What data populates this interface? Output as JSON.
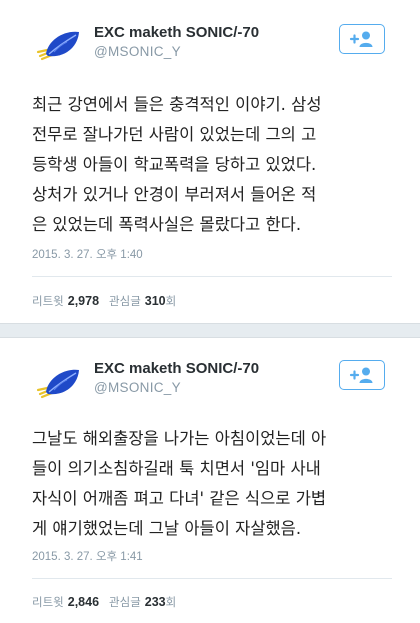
{
  "colors": {
    "accent": "#55acee",
    "meta": "#8899a6",
    "text": "#292f33",
    "separator": "#e6ecf0"
  },
  "tweets": [
    {
      "display_name": "EXC maketh SONIC/-70",
      "handle": "@MSONIC_Y",
      "avatar_icon": "blue-leaf-avatar-icon",
      "follow_icon": "add-user-icon",
      "text": "최근 강연에서 들은 충격적인 이야기. 삼성\n전무로 잘나가던 사람이 있었는데 그의 고\n등학생 아들이 학교폭력을 당하고 있었다.\n상처가 있거나 안경이 부러져서 들어온 적\n은 있었는데 폭력사실은 몰랐다고 한다.",
      "timestamp": "2015. 3. 27. 오후 1:40",
      "retweets_label": "리트윗",
      "retweets": "2,978",
      "favorites_label": "관심글",
      "favorites": "310",
      "favorites_suffix": "회"
    },
    {
      "display_name": "EXC maketh SONIC/-70",
      "handle": "@MSONIC_Y",
      "avatar_icon": "blue-leaf-avatar-icon",
      "follow_icon": "add-user-icon",
      "text": "그날도 해외출장을 나가는 아침이었는데 아\n들이 의기소침하길래 툭 치면서 '임마 사내\n자식이 어깨좀 펴고 다녀' 같은 식으로 가볍\n게 얘기했었는데 그날 아들이 자살했음.",
      "timestamp": "2015. 3. 27. 오후 1:41",
      "retweets_label": "리트윗",
      "retweets": "2,846",
      "favorites_label": "관심글",
      "favorites": "233",
      "favorites_suffix": "회"
    }
  ]
}
